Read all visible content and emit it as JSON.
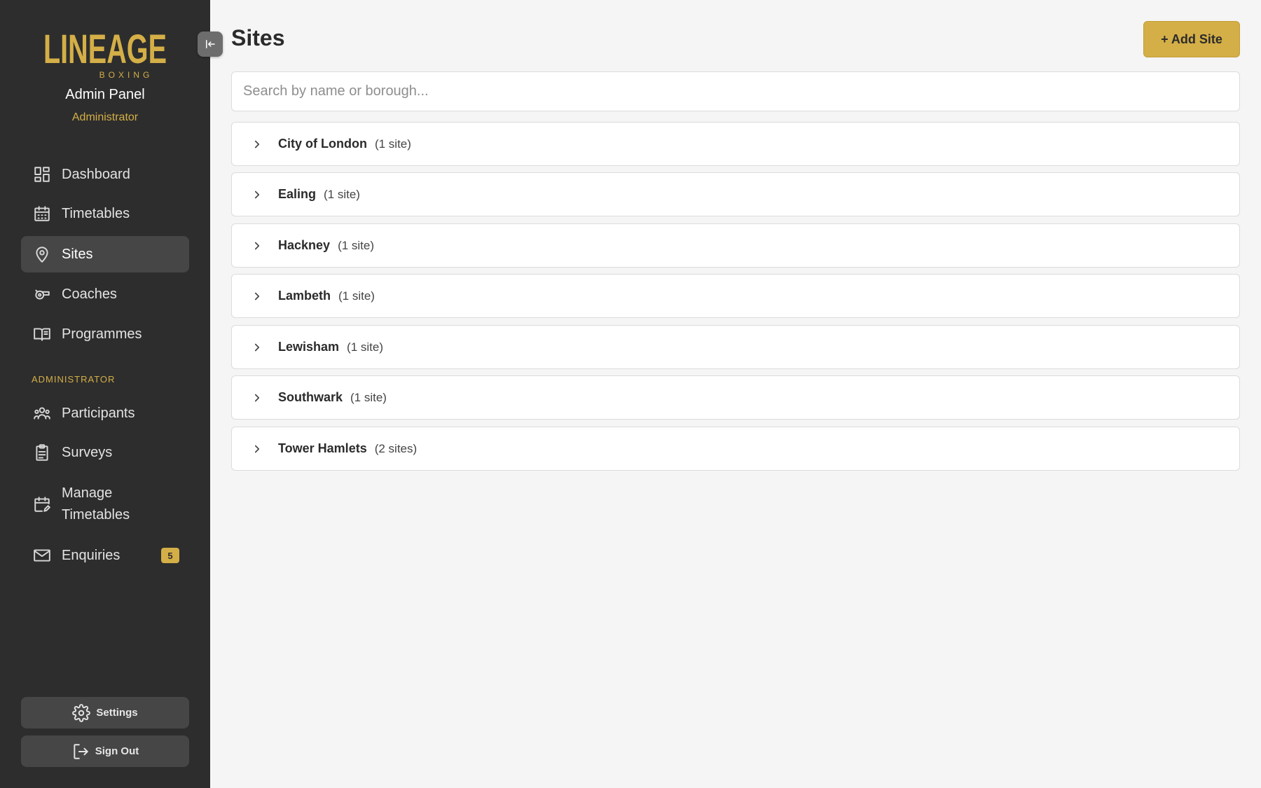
{
  "sidebar": {
    "logo": {
      "main": "LINEAGE",
      "sub": "BOXING",
      "accent": "#d4af47"
    },
    "panel_title": "Admin Panel",
    "role": "Administrator",
    "nav": [
      {
        "label": "Dashboard",
        "icon": "dashboard-icon"
      },
      {
        "label": "Timetables",
        "icon": "calendar-icon"
      },
      {
        "label": "Sites",
        "icon": "location-pin-icon",
        "active": true
      },
      {
        "label": "Coaches",
        "icon": "whistle-icon"
      },
      {
        "label": "Programmes",
        "icon": "book-icon"
      }
    ],
    "admin_section_label": "ADMINISTRATOR",
    "admin_nav": [
      {
        "label": "Participants",
        "icon": "group-icon"
      },
      {
        "label": "Surveys",
        "icon": "clipboard-icon"
      },
      {
        "label": "Manage Timetables",
        "icon": "calendar-edit-icon"
      },
      {
        "label": "Enquiries",
        "icon": "mail-icon",
        "badge": "5"
      }
    ],
    "settings_label": "Settings",
    "signout_label": "Sign Out"
  },
  "main": {
    "title": "Sites",
    "add_button": "+ Add Site",
    "search_placeholder": "Search by name or borough...",
    "boroughs": [
      {
        "name": "City of London",
        "count": "(1 site)"
      },
      {
        "name": "Ealing",
        "count": "(1 site)"
      },
      {
        "name": "Hackney",
        "count": "(1 site)"
      },
      {
        "name": "Lambeth",
        "count": "(1 site)"
      },
      {
        "name": "Lewisham",
        "count": "(1 site)"
      },
      {
        "name": "Southwark",
        "count": "(1 site)"
      },
      {
        "name": "Tower Hamlets",
        "count": "(2 sites)"
      }
    ]
  },
  "colors": {
    "sidebar_bg": "#2d2d2d",
    "accent": "#d4af47",
    "page_bg": "#f5f5f5"
  }
}
